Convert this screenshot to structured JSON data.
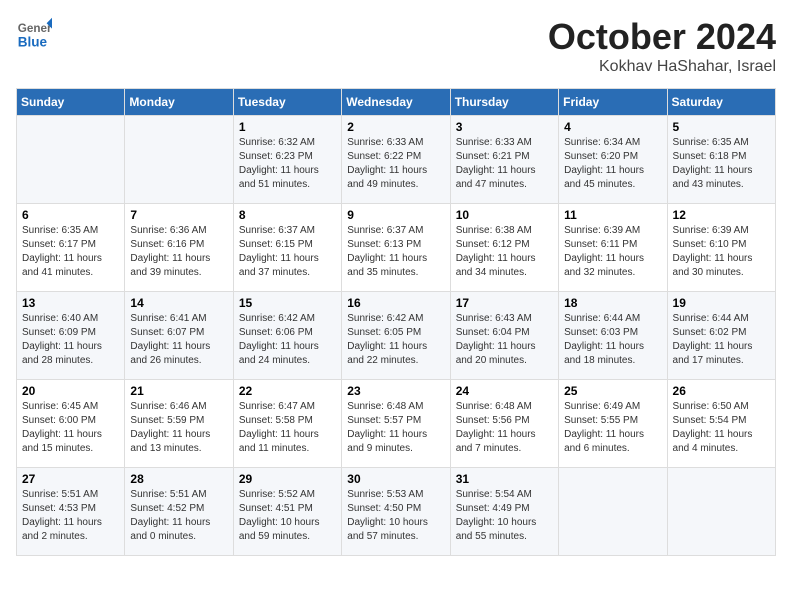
{
  "header": {
    "logo_general": "General",
    "logo_blue": "Blue",
    "month": "October 2024",
    "location": "Kokhav HaShahar, Israel"
  },
  "weekdays": [
    "Sunday",
    "Monday",
    "Tuesday",
    "Wednesday",
    "Thursday",
    "Friday",
    "Saturday"
  ],
  "weeks": [
    [
      {
        "day": "",
        "sunrise": "",
        "sunset": "",
        "daylight": ""
      },
      {
        "day": "",
        "sunrise": "",
        "sunset": "",
        "daylight": ""
      },
      {
        "day": "1",
        "sunrise": "Sunrise: 6:32 AM",
        "sunset": "Sunset: 6:23 PM",
        "daylight": "Daylight: 11 hours and 51 minutes."
      },
      {
        "day": "2",
        "sunrise": "Sunrise: 6:33 AM",
        "sunset": "Sunset: 6:22 PM",
        "daylight": "Daylight: 11 hours and 49 minutes."
      },
      {
        "day": "3",
        "sunrise": "Sunrise: 6:33 AM",
        "sunset": "Sunset: 6:21 PM",
        "daylight": "Daylight: 11 hours and 47 minutes."
      },
      {
        "day": "4",
        "sunrise": "Sunrise: 6:34 AM",
        "sunset": "Sunset: 6:20 PM",
        "daylight": "Daylight: 11 hours and 45 minutes."
      },
      {
        "day": "5",
        "sunrise": "Sunrise: 6:35 AM",
        "sunset": "Sunset: 6:18 PM",
        "daylight": "Daylight: 11 hours and 43 minutes."
      }
    ],
    [
      {
        "day": "6",
        "sunrise": "Sunrise: 6:35 AM",
        "sunset": "Sunset: 6:17 PM",
        "daylight": "Daylight: 11 hours and 41 minutes."
      },
      {
        "day": "7",
        "sunrise": "Sunrise: 6:36 AM",
        "sunset": "Sunset: 6:16 PM",
        "daylight": "Daylight: 11 hours and 39 minutes."
      },
      {
        "day": "8",
        "sunrise": "Sunrise: 6:37 AM",
        "sunset": "Sunset: 6:15 PM",
        "daylight": "Daylight: 11 hours and 37 minutes."
      },
      {
        "day": "9",
        "sunrise": "Sunrise: 6:37 AM",
        "sunset": "Sunset: 6:13 PM",
        "daylight": "Daylight: 11 hours and 35 minutes."
      },
      {
        "day": "10",
        "sunrise": "Sunrise: 6:38 AM",
        "sunset": "Sunset: 6:12 PM",
        "daylight": "Daylight: 11 hours and 34 minutes."
      },
      {
        "day": "11",
        "sunrise": "Sunrise: 6:39 AM",
        "sunset": "Sunset: 6:11 PM",
        "daylight": "Daylight: 11 hours and 32 minutes."
      },
      {
        "day": "12",
        "sunrise": "Sunrise: 6:39 AM",
        "sunset": "Sunset: 6:10 PM",
        "daylight": "Daylight: 11 hours and 30 minutes."
      }
    ],
    [
      {
        "day": "13",
        "sunrise": "Sunrise: 6:40 AM",
        "sunset": "Sunset: 6:09 PM",
        "daylight": "Daylight: 11 hours and 28 minutes."
      },
      {
        "day": "14",
        "sunrise": "Sunrise: 6:41 AM",
        "sunset": "Sunset: 6:07 PM",
        "daylight": "Daylight: 11 hours and 26 minutes."
      },
      {
        "day": "15",
        "sunrise": "Sunrise: 6:42 AM",
        "sunset": "Sunset: 6:06 PM",
        "daylight": "Daylight: 11 hours and 24 minutes."
      },
      {
        "day": "16",
        "sunrise": "Sunrise: 6:42 AM",
        "sunset": "Sunset: 6:05 PM",
        "daylight": "Daylight: 11 hours and 22 minutes."
      },
      {
        "day": "17",
        "sunrise": "Sunrise: 6:43 AM",
        "sunset": "Sunset: 6:04 PM",
        "daylight": "Daylight: 11 hours and 20 minutes."
      },
      {
        "day": "18",
        "sunrise": "Sunrise: 6:44 AM",
        "sunset": "Sunset: 6:03 PM",
        "daylight": "Daylight: 11 hours and 18 minutes."
      },
      {
        "day": "19",
        "sunrise": "Sunrise: 6:44 AM",
        "sunset": "Sunset: 6:02 PM",
        "daylight": "Daylight: 11 hours and 17 minutes."
      }
    ],
    [
      {
        "day": "20",
        "sunrise": "Sunrise: 6:45 AM",
        "sunset": "Sunset: 6:00 PM",
        "daylight": "Daylight: 11 hours and 15 minutes."
      },
      {
        "day": "21",
        "sunrise": "Sunrise: 6:46 AM",
        "sunset": "Sunset: 5:59 PM",
        "daylight": "Daylight: 11 hours and 13 minutes."
      },
      {
        "day": "22",
        "sunrise": "Sunrise: 6:47 AM",
        "sunset": "Sunset: 5:58 PM",
        "daylight": "Daylight: 11 hours and 11 minutes."
      },
      {
        "day": "23",
        "sunrise": "Sunrise: 6:48 AM",
        "sunset": "Sunset: 5:57 PM",
        "daylight": "Daylight: 11 hours and 9 minutes."
      },
      {
        "day": "24",
        "sunrise": "Sunrise: 6:48 AM",
        "sunset": "Sunset: 5:56 PM",
        "daylight": "Daylight: 11 hours and 7 minutes."
      },
      {
        "day": "25",
        "sunrise": "Sunrise: 6:49 AM",
        "sunset": "Sunset: 5:55 PM",
        "daylight": "Daylight: 11 hours and 6 minutes."
      },
      {
        "day": "26",
        "sunrise": "Sunrise: 6:50 AM",
        "sunset": "Sunset: 5:54 PM",
        "daylight": "Daylight: 11 hours and 4 minutes."
      }
    ],
    [
      {
        "day": "27",
        "sunrise": "Sunrise: 5:51 AM",
        "sunset": "Sunset: 4:53 PM",
        "daylight": "Daylight: 11 hours and 2 minutes."
      },
      {
        "day": "28",
        "sunrise": "Sunrise: 5:51 AM",
        "sunset": "Sunset: 4:52 PM",
        "daylight": "Daylight: 11 hours and 0 minutes."
      },
      {
        "day": "29",
        "sunrise": "Sunrise: 5:52 AM",
        "sunset": "Sunset: 4:51 PM",
        "daylight": "Daylight: 10 hours and 59 minutes."
      },
      {
        "day": "30",
        "sunrise": "Sunrise: 5:53 AM",
        "sunset": "Sunset: 4:50 PM",
        "daylight": "Daylight: 10 hours and 57 minutes."
      },
      {
        "day": "31",
        "sunrise": "Sunrise: 5:54 AM",
        "sunset": "Sunset: 4:49 PM",
        "daylight": "Daylight: 10 hours and 55 minutes."
      },
      {
        "day": "",
        "sunrise": "",
        "sunset": "",
        "daylight": ""
      },
      {
        "day": "",
        "sunrise": "",
        "sunset": "",
        "daylight": ""
      }
    ]
  ]
}
